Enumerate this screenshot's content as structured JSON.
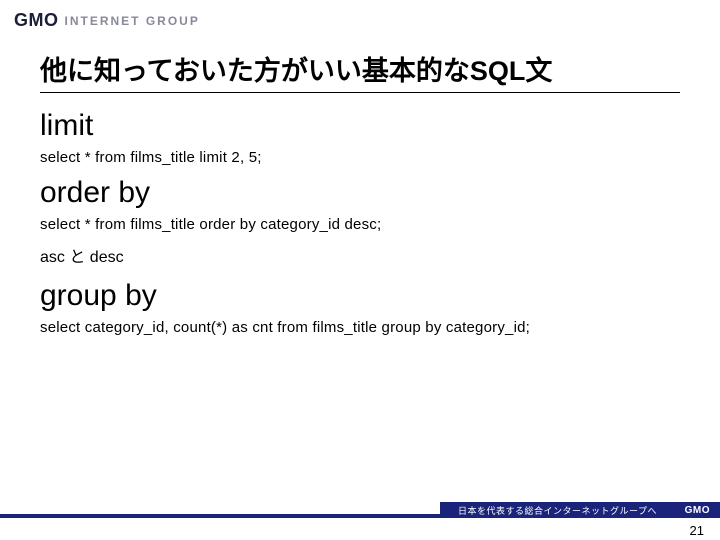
{
  "header": {
    "logo_main": "GMO",
    "logo_sub": "INTERNET GROUP"
  },
  "slide": {
    "title": "他に知っておいた方がいい基本的なSQL文",
    "sections": [
      {
        "heading": "limit",
        "code": "select * from films_title limit 2, 5;"
      },
      {
        "heading": "order by",
        "code": "select * from films_title order by category_id desc;",
        "note": "asc と desc"
      },
      {
        "heading": "group by",
        "code": "select category_id, count(*) as cnt from films_title group by category_id;"
      }
    ]
  },
  "footer": {
    "tagline": "日本を代表する総合インターネットグループへ",
    "logo": "GMO",
    "page": "21"
  }
}
